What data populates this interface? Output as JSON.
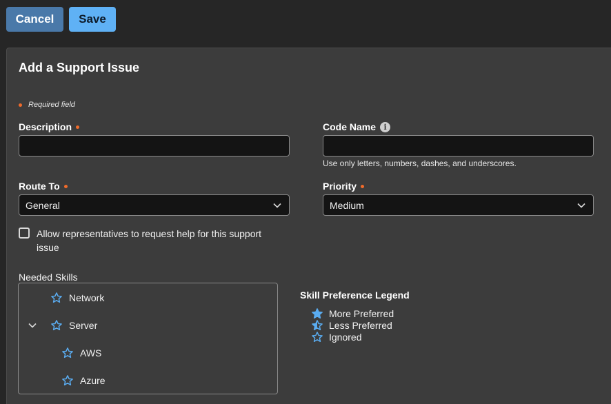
{
  "toolbar": {
    "cancel_label": "Cancel",
    "save_label": "Save"
  },
  "form": {
    "title": "Add a Support Issue",
    "required_note": "Required field",
    "description": {
      "label": "Description",
      "value": "",
      "required": true
    },
    "code_name": {
      "label": "Code Name",
      "value": "",
      "hint": "Use only letters, numbers, dashes, and underscores.",
      "info_icon": "info-icon"
    },
    "route_to": {
      "label": "Route To",
      "value": "General",
      "required": true
    },
    "priority": {
      "label": "Priority",
      "value": "Medium",
      "required": true
    },
    "allow_help": {
      "label": "Allow representatives to request help for this support issue",
      "checked": false
    },
    "skills": {
      "label": "Needed Skills",
      "items": [
        {
          "label": "Network",
          "level": 0,
          "expandable": false,
          "preference": "Ignored"
        },
        {
          "label": "Server",
          "level": 0,
          "expandable": true,
          "expanded": true,
          "preference": "Ignored"
        },
        {
          "label": "AWS",
          "level": 1,
          "expandable": false,
          "preference": "Ignored"
        },
        {
          "label": "Azure",
          "level": 1,
          "expandable": false,
          "preference": "Ignored"
        }
      ]
    },
    "legend": {
      "title": "Skill Preference Legend",
      "items": [
        {
          "label": "More Preferred",
          "icon": "star-filled-icon"
        },
        {
          "label": "Less Preferred",
          "icon": "star-half-icon"
        },
        {
          "label": "Ignored",
          "icon": "star-outline-icon"
        }
      ]
    }
  },
  "colors": {
    "background": "#262626",
    "panel": "#3c3c3c",
    "cancel_button": "#4a79a9",
    "save_button": "#5fb1f5",
    "required_dot": "#f06b2b",
    "star": "#5aacf0",
    "input_bg": "#141414"
  }
}
